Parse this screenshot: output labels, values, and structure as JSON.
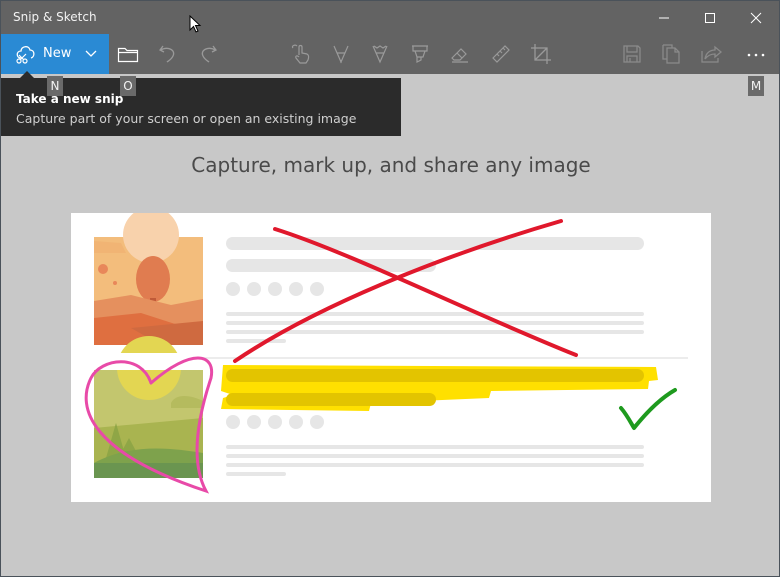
{
  "window": {
    "title": "Snip & Sketch",
    "controls": [
      "minimize",
      "maximize",
      "close"
    ]
  },
  "toolbar": {
    "new_label": "New",
    "new_icon": "snip-icon",
    "items": [
      {
        "name": "new-dropdown",
        "icon": "chevron-down-icon"
      },
      {
        "name": "open-file",
        "icon": "folder-icon"
      },
      {
        "name": "undo",
        "icon": "undo-icon"
      },
      {
        "name": "redo",
        "icon": "redo-icon"
      },
      {
        "name": "touch-writing",
        "icon": "touch-writing-icon"
      },
      {
        "name": "ballpoint-pen",
        "icon": "ballpoint-pen-icon"
      },
      {
        "name": "pencil",
        "icon": "pencil-icon"
      },
      {
        "name": "highlighter",
        "icon": "highlighter-icon"
      },
      {
        "name": "eraser",
        "icon": "eraser-icon"
      },
      {
        "name": "ruler",
        "icon": "ruler-icon"
      },
      {
        "name": "crop",
        "icon": "crop-icon"
      },
      {
        "name": "save",
        "icon": "save-icon"
      },
      {
        "name": "copy",
        "icon": "copy-icon"
      },
      {
        "name": "share",
        "icon": "share-icon"
      },
      {
        "name": "more",
        "icon": "more-icon",
        "label": "..."
      }
    ]
  },
  "keytips": {
    "new": "N",
    "open": "O",
    "more": "M"
  },
  "tooltip": {
    "title": "Take a new snip",
    "description": "Capture part of your screen or open an existing image"
  },
  "main": {
    "headline": "Capture, mark up, and share any image"
  },
  "colors": {
    "accent": "#2a8ad4",
    "titlebar": "#636363",
    "canvas": "#c8c8c8",
    "ink_red": "#e0182c",
    "ink_pink": "#e84aa8",
    "ink_green": "#1e9a1e",
    "highlighter_yellow": "#ffe000"
  }
}
